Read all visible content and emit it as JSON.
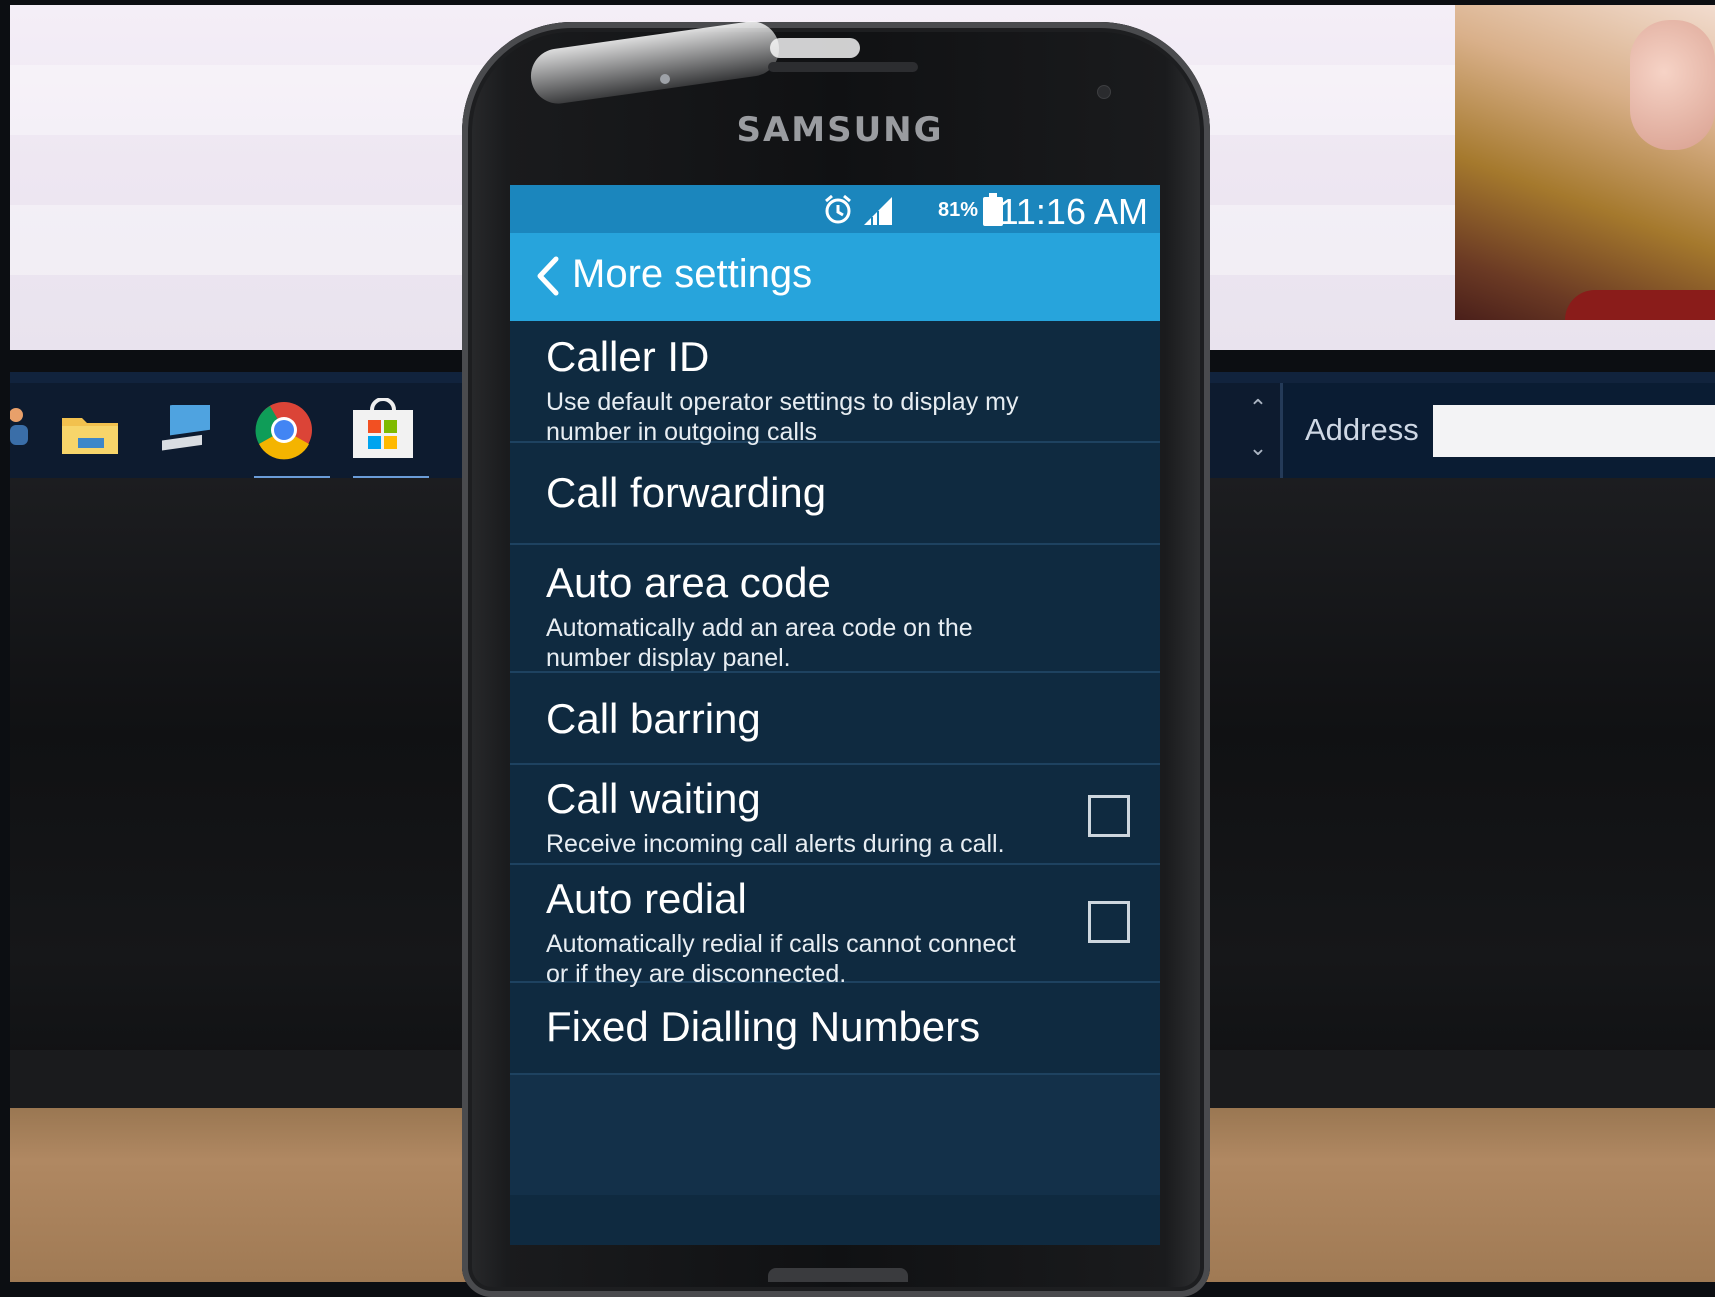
{
  "status_bar": {
    "battery_percent": "81%",
    "time": "11:16 AM",
    "icons": [
      "alarm-icon",
      "signal-icon",
      "battery-icon"
    ]
  },
  "action_bar": {
    "back_icon": "chevron-left-icon",
    "title": "More settings"
  },
  "settings": [
    {
      "title": "Caller ID",
      "summary": "Use default operator settings to display my number in outgoing calls"
    },
    {
      "title": "Call forwarding"
    },
    {
      "title": "Auto area code",
      "summary": "Automatically add an area code on the number display panel."
    },
    {
      "title": "Call barring"
    },
    {
      "title": "Call waiting",
      "summary": "Receive incoming call alerts during a call.",
      "checked": false
    },
    {
      "title": "Auto redial",
      "summary": "Automatically redial if calls cannot connect or if they are disconnected.",
      "checked": false
    },
    {
      "title": "Fixed Dialling Numbers"
    }
  ],
  "device": {
    "brand": "SAMSUNG"
  },
  "background_desktop": {
    "address_label": "Address",
    "taskbar_icons": [
      "user-icon",
      "file-explorer-icon",
      "computer-icon",
      "chrome-icon",
      "store-icon"
    ]
  },
  "colors": {
    "status_bar": "#1b86bd",
    "action_bar": "#27a4dc",
    "list_background": "#0f2a40",
    "divider": "#1e4260"
  }
}
